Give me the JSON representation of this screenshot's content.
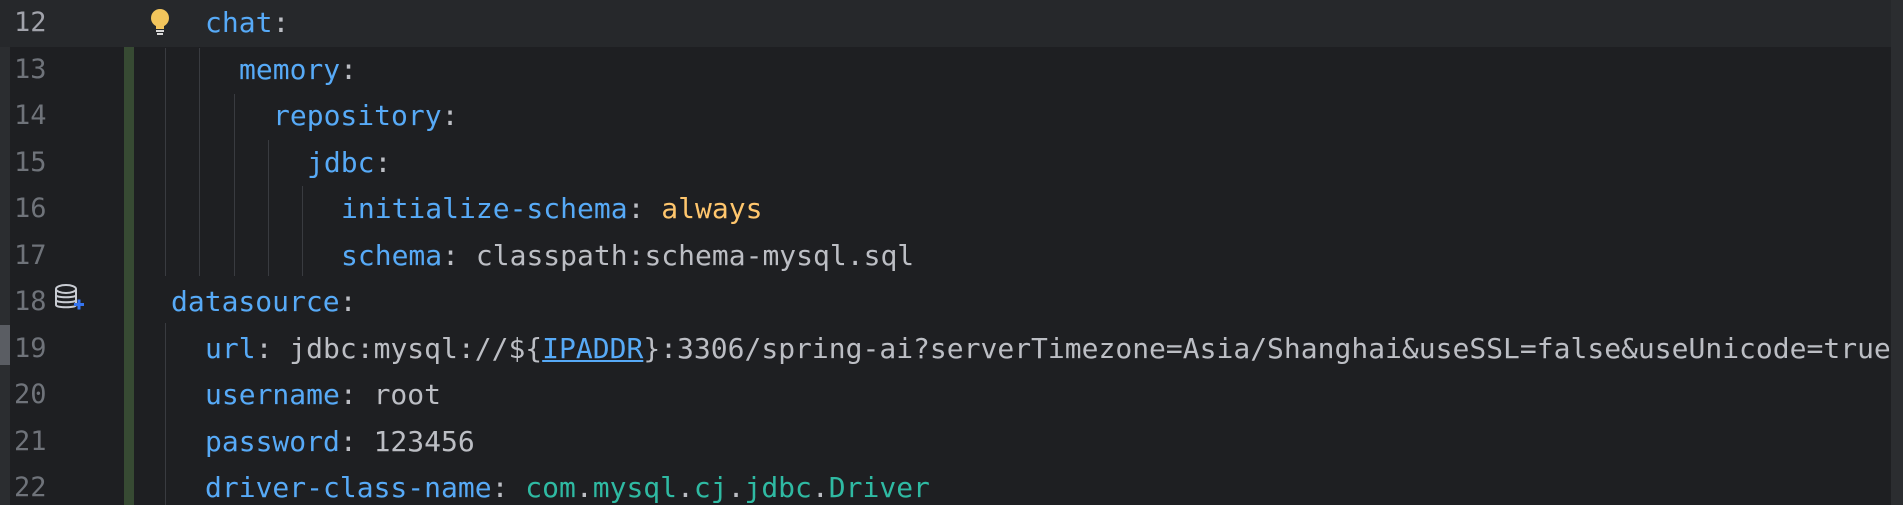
{
  "editor": {
    "lines": [
      {
        "number": "12",
        "indent": 0,
        "key": "chat",
        "sep": ":",
        "value": "",
        "current": true
      },
      {
        "number": "13",
        "indent": 1,
        "key": "memory",
        "sep": ":",
        "value": ""
      },
      {
        "number": "14",
        "indent": 2,
        "key": "repository",
        "sep": ":",
        "value": ""
      },
      {
        "number": "15",
        "indent": 3,
        "key": "jdbc",
        "sep": ":",
        "value": ""
      },
      {
        "number": "16",
        "indent": 4,
        "key": "initialize-schema",
        "sep": ": ",
        "value": "always"
      },
      {
        "number": "17",
        "indent": 4,
        "key": "schema",
        "sep": ": ",
        "value": "classpath:schema-mysql.sql"
      },
      {
        "number": "18",
        "indent": -1,
        "key": "datasource",
        "sep": ":",
        "value": ""
      },
      {
        "number": "19",
        "indent": 0,
        "key": "url",
        "sep": ": ",
        "value_prefix": "jdbc:mysql://${",
        "value_link": "IPADDR",
        "value_suffix": "}:3306/spring-ai?serverTimezone=Asia/Shanghai&useSSL=false&useUnicode=true"
      },
      {
        "number": "20",
        "indent": 0,
        "key": "username",
        "sep": ": ",
        "value": "root"
      },
      {
        "number": "21",
        "indent": 0,
        "key": "password",
        "sep": ": ",
        "value": "123456"
      },
      {
        "number": "22",
        "indent": 0,
        "key": "driver-class-name",
        "sep": ": ",
        "value_cls_parts": [
          "com",
          "mysql",
          "cj",
          "jdbc",
          "Driver"
        ]
      }
    ],
    "icons": {
      "bulb": "lightbulb-icon",
      "datasource": "database-add-icon"
    },
    "colors": {
      "background": "#1e1f22",
      "key": "#57aaf7",
      "keyword_value": "#ffc66d",
      "class_value": "#2fbaa3",
      "plain": "#bcbec4",
      "line_number": "#6f737a"
    }
  }
}
